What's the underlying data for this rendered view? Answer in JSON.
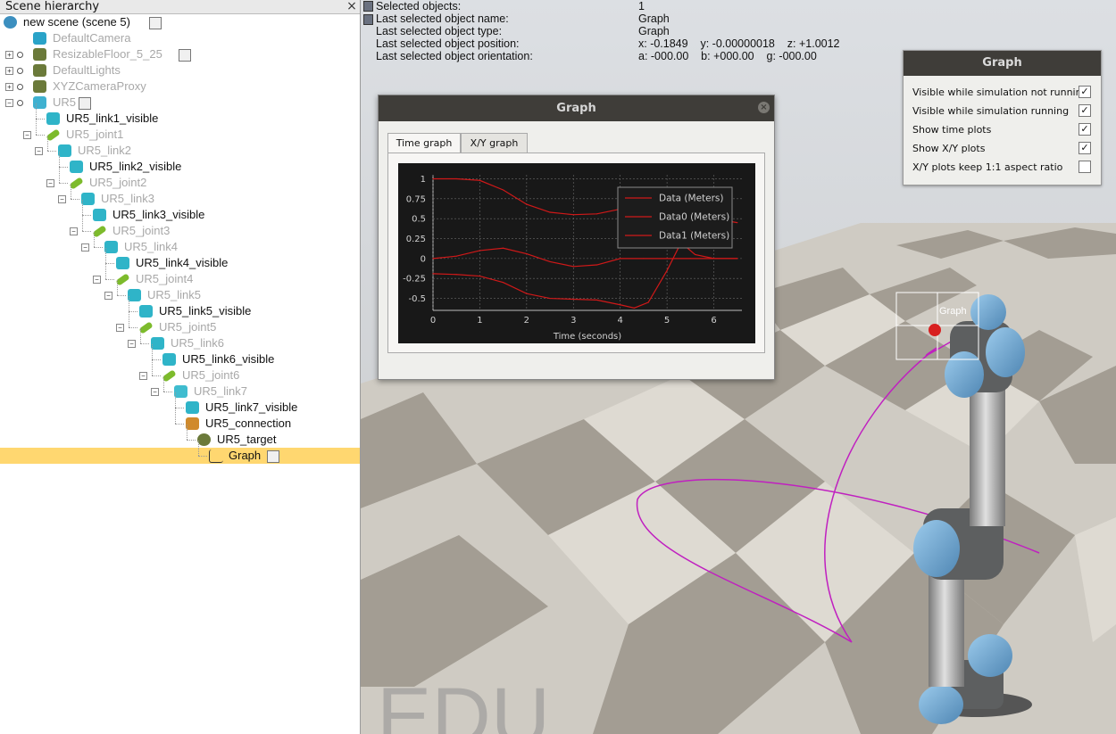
{
  "hierarchy": {
    "title": "Scene hierarchy",
    "close_glyph": "×",
    "items": [
      {
        "label": "new scene (scene 5)",
        "icon": "world-icon",
        "depth": 0,
        "style": "dark"
      },
      {
        "label": "DefaultCamera",
        "icon": "camera-icon",
        "depth": 1,
        "style": "dim"
      },
      {
        "label": "ResizableFloor_5_25",
        "icon": "floor-icon",
        "depth": 1,
        "style": "dim"
      },
      {
        "label": "DefaultLights",
        "icon": "light-icon",
        "depth": 1,
        "style": "dim"
      },
      {
        "label": "XYZCameraProxy",
        "icon": "proxy-icon",
        "depth": 1,
        "style": "dim"
      },
      {
        "label": "UR5",
        "icon": "model-icon",
        "depth": 1,
        "style": "dim"
      },
      {
        "label": "UR5_link1_visible",
        "icon": "shape-icon",
        "depth": 2,
        "style": "dark"
      },
      {
        "label": "UR5_joint1",
        "icon": "joint-icon",
        "depth": 2,
        "style": "dim"
      },
      {
        "label": "UR5_link2",
        "icon": "shape-icon",
        "depth": 3,
        "style": "dim"
      },
      {
        "label": "UR5_link2_visible",
        "icon": "shape-icon",
        "depth": 4,
        "style": "dark"
      },
      {
        "label": "UR5_joint2",
        "icon": "joint-icon",
        "depth": 4,
        "style": "dim"
      },
      {
        "label": "UR5_link3",
        "icon": "shape-icon",
        "depth": 5,
        "style": "dim"
      },
      {
        "label": "UR5_link3_visible",
        "icon": "shape-icon",
        "depth": 6,
        "style": "dark"
      },
      {
        "label": "UR5_joint3",
        "icon": "joint-icon",
        "depth": 6,
        "style": "dim"
      },
      {
        "label": "UR5_link4",
        "icon": "shape-icon",
        "depth": 7,
        "style": "dim"
      },
      {
        "label": "UR5_link4_visible",
        "icon": "shape-icon",
        "depth": 8,
        "style": "dark"
      },
      {
        "label": "UR5_joint4",
        "icon": "joint-icon",
        "depth": 8,
        "style": "dim"
      },
      {
        "label": "UR5_link5",
        "icon": "shape-icon",
        "depth": 9,
        "style": "dim"
      },
      {
        "label": "UR5_link5_visible",
        "icon": "shape-icon",
        "depth": 10,
        "style": "dark"
      },
      {
        "label": "UR5_joint5",
        "icon": "joint-icon",
        "depth": 10,
        "style": "dim"
      },
      {
        "label": "UR5_link6",
        "icon": "shape-icon",
        "depth": 11,
        "style": "dim"
      },
      {
        "label": "UR5_link6_visible",
        "icon": "shape-icon",
        "depth": 12,
        "style": "dark"
      },
      {
        "label": "UR5_joint6",
        "icon": "joint-icon",
        "depth": 12,
        "style": "dim"
      },
      {
        "label": "UR5_link7",
        "icon": "cube-icon",
        "depth": 13,
        "style": "dim"
      },
      {
        "label": "UR5_link7_visible",
        "icon": "shape-icon",
        "depth": 14,
        "style": "dark"
      },
      {
        "label": "UR5_connection",
        "icon": "connector-icon",
        "depth": 14,
        "style": "dark"
      },
      {
        "label": "UR5_target",
        "icon": "dummy-icon",
        "depth": 15,
        "style": "dark"
      },
      {
        "label": "Graph",
        "icon": "graph-icon",
        "depth": 16,
        "style": "dark",
        "selected": true
      }
    ]
  },
  "info": {
    "rows": [
      {
        "label": "Selected objects:",
        "value": "1"
      },
      {
        "label": "Last selected object name:",
        "value": "Graph"
      },
      {
        "label": "Last selected object type:",
        "value": "Graph"
      },
      {
        "label": "Last selected object position:",
        "value": "x: -0.1849    y: -0.00000018    z: +1.0012"
      },
      {
        "label": "Last selected object orientation:",
        "value": "a: -000.00    b: +000.00    g: -000.00"
      }
    ]
  },
  "graph_props": {
    "title": "Graph",
    "options": [
      {
        "label": "Visible while simulation not running",
        "checked": true
      },
      {
        "label": "Visible while simulation running",
        "checked": true
      },
      {
        "label": "Show time plots",
        "checked": true
      },
      {
        "label": "Show X/Y plots",
        "checked": true
      },
      {
        "label": "X/Y plots keep 1:1 aspect ratio",
        "checked": false
      }
    ],
    "check_glyph": "✓"
  },
  "graph_window": {
    "title": "Graph",
    "close_glyph": "×",
    "tabs": [
      "Time graph",
      "X/Y graph"
    ],
    "active_tab": 0
  },
  "viewport": {
    "watermark": "EDU",
    "graph_tag": "Graph",
    "colors": {
      "path": "#c020c0",
      "arm_joint": "#6fa8d8",
      "arm_body": "#aaaaaa"
    }
  },
  "chart_data": {
    "type": "line",
    "xlabel": "Time (seconds)",
    "ylabel": "",
    "xlim": [
      0,
      6.6
    ],
    "ylim": [
      -0.65,
      1.05
    ],
    "xticks": [
      0,
      1,
      2,
      3,
      4,
      5,
      6
    ],
    "yticks": [
      1,
      0.75,
      0.5,
      0.25,
      0,
      -0.25,
      -0.5
    ],
    "ytick_labels": [
      "1",
      "0.75",
      "0.5",
      "0.25",
      "0",
      "-0.25",
      "-0.5"
    ],
    "grid": true,
    "legend_position": "top-right",
    "line_color": "#d01818",
    "series": [
      {
        "name": "Data (Meters)",
        "x": [
          0,
          0.5,
          1,
          1.5,
          2,
          2.5,
          3,
          3.5,
          4,
          4.5,
          5,
          5.5,
          6,
          6.5
        ],
        "y": [
          1.0,
          1.0,
          0.98,
          0.86,
          0.68,
          0.58,
          0.55,
          0.56,
          0.62,
          0.62,
          0.58,
          0.55,
          0.5,
          0.45
        ]
      },
      {
        "name": "Data0 (Meters)",
        "x": [
          0,
          0.5,
          1,
          1.5,
          2,
          2.5,
          3,
          3.5,
          4,
          4.5,
          5,
          5.5,
          6,
          6.5
        ],
        "y": [
          0.0,
          0.03,
          0.1,
          0.13,
          0.06,
          -0.04,
          -0.1,
          -0.08,
          0.0,
          0.0,
          0.0,
          0.0,
          0.0,
          0.0
        ]
      },
      {
        "name": "Data1 (Meters)",
        "x": [
          0,
          0.5,
          1,
          1.5,
          2,
          2.5,
          3,
          3.5,
          4,
          4.3,
          4.6,
          5,
          5.3,
          5.6,
          6,
          6.5
        ],
        "y": [
          -0.19,
          -0.2,
          -0.22,
          -0.3,
          -0.44,
          -0.5,
          -0.51,
          -0.52,
          -0.58,
          -0.62,
          -0.55,
          -0.15,
          0.2,
          0.05,
          0.0,
          0.0
        ]
      }
    ]
  }
}
